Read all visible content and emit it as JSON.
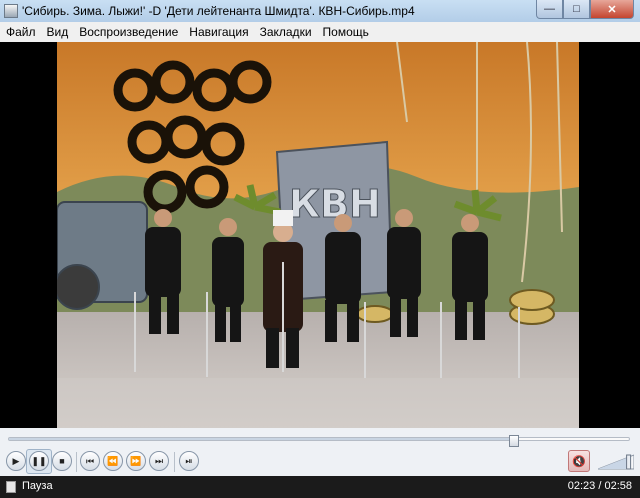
{
  "window": {
    "title": "'Сибирь. Зима. Лыжи!' -D 'Дети лейтенанта Шмидта'. КВН-Сибирь.mp4",
    "icon": "film-icon"
  },
  "menu": [
    "Файл",
    "Вид",
    "Воспроизведение",
    "Навигация",
    "Закладки",
    "Помощь"
  ],
  "video": {
    "stage_sign": "КВН"
  },
  "seekbar": {
    "progress_fraction": 0.814
  },
  "controls": {
    "play_icon": "play-icon",
    "pause_icon": "pause-icon",
    "stop_icon": "stop-icon",
    "prev_icon": "skip-back-icon",
    "rewind_icon": "rewind-icon",
    "forward_icon": "fast-forward-icon",
    "next_icon": "skip-forward-icon",
    "frame_step_icon": "frame-step-icon",
    "mute_icon": "mute-icon",
    "volume_level": 0.85
  },
  "status": {
    "state": "Пауза",
    "time": "02:23 / 02:58"
  },
  "colors": {
    "titlebar": "#b3cde8",
    "close": "#c4452f",
    "statusbar": "#1b1b1b"
  }
}
